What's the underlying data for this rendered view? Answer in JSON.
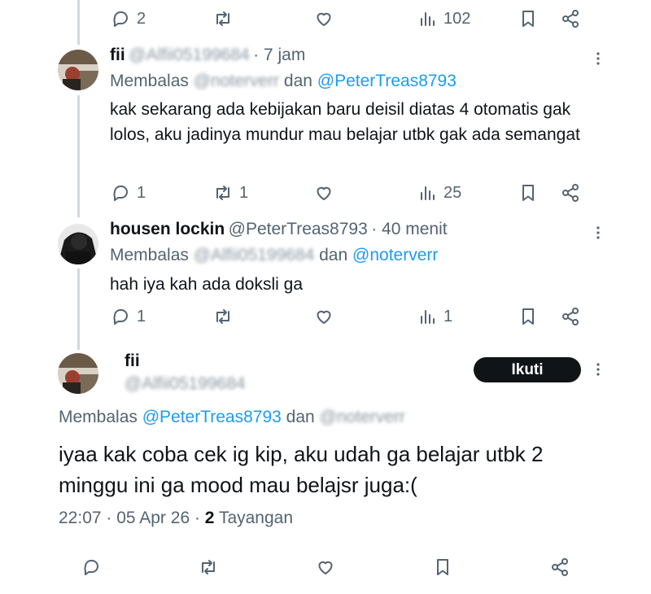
{
  "top_actions": {
    "reply_count": "2",
    "retweet_count": "",
    "view_count": "102"
  },
  "reply1": {
    "name": "fii",
    "handle": "@Alfii05199684",
    "time": "· 7 jam",
    "replying_prefix": "Membalas ",
    "replying_mention1": "@noterverr",
    "replying_and": " dan ",
    "replying_mention2": "@PeterTreas8793",
    "text": "kak sekarang ada kebijakan baru deisil diatas 4 otomatis gak lolos, aku jadinya mundur mau belajar utbk gak ada semangat",
    "reply_count": "1",
    "retweet_count": "1",
    "view_count": "25"
  },
  "reply2": {
    "name": "housen lockin",
    "handle": "@PeterTreas8793",
    "time": "· 40 menit",
    "replying_prefix": "Membalas ",
    "replying_mention1": "@Alfii05199684",
    "replying_and": " dan ",
    "replying_mention2": "@noterverr",
    "text": "hah iya kah ada doksli ga",
    "reply_count": "1",
    "view_count": "1"
  },
  "main": {
    "name": "fii",
    "handle": "@Alfii05199684",
    "follow_label": "Ikuti",
    "replying_prefix": "Membalas ",
    "replying_mention1": "@PeterTreas8793",
    "replying_and": " dan ",
    "replying_mention2": "@noterverr",
    "text": "iyaa kak coba cek ig kip, aku udah ga belajar utbk 2 minggu ini ga mood mau belajsr juga:(",
    "timestamp": "22:07 · 05 Apr 26 · ",
    "views_count": "2",
    "views_label": " Tayangan"
  },
  "colors": {
    "text": "#0f1419",
    "muted": "#536471",
    "link": "#1d9bf0",
    "thread_line": "#cfd9de",
    "button": "#0f1419"
  },
  "icons": [
    "reply-icon",
    "retweet-icon",
    "like-icon",
    "views-icon",
    "bookmark-icon",
    "share-icon",
    "more-icon"
  ]
}
